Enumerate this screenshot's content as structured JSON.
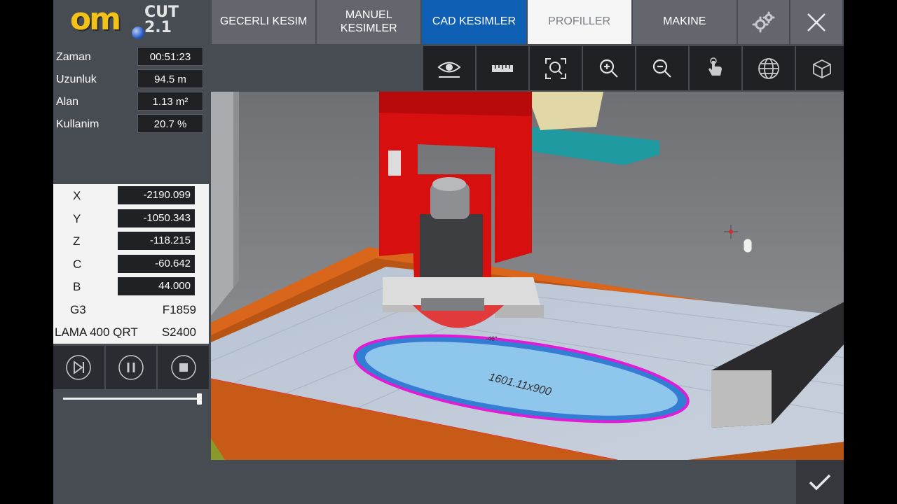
{
  "app": {
    "logo_text": "om",
    "version": "CUT 2.1"
  },
  "nav": {
    "tabs": [
      {
        "label": "GECERLI KESIM",
        "active": false
      },
      {
        "label": "MANUEL\nKESIMLER",
        "active": false
      },
      {
        "label": "CAD KESIMLER",
        "active": true
      },
      {
        "label": "PROFILLER",
        "active": false
      },
      {
        "label": "MAKINE",
        "active": false
      }
    ],
    "settings_icon": "gears-icon",
    "close_icon": "close-icon"
  },
  "toolbar": [
    "eye-icon",
    "ruler-icon",
    "zoom-fit-icon",
    "zoom-in-icon",
    "zoom-out-icon",
    "touch-hand-icon",
    "globe-icon",
    "cube-icon"
  ],
  "stats": [
    {
      "label": "Zaman",
      "value": "00:51:23"
    },
    {
      "label": "Uzunluk",
      "value": "94.5 m"
    },
    {
      "label": "Alan",
      "value": "1.13 m²"
    },
    {
      "label": "Kullanim",
      "value": "20.7 %"
    }
  ],
  "coords": [
    {
      "label": "X",
      "value": "-2190.099"
    },
    {
      "label": "Y",
      "value": "-1050.343"
    },
    {
      "label": "Z",
      "value": "-118.215"
    },
    {
      "label": "C",
      "value": "-60.642"
    },
    {
      "label": "B",
      "value": "44.000"
    }
  ],
  "status": {
    "gcode": "G3",
    "feed": "F1859",
    "tool": "LAMA 400 QRT",
    "speed": "S2400"
  },
  "playback": {
    "progress": 1.0
  },
  "viewport": {
    "shape_label": "1601.11x900",
    "angle_label": "-46°"
  },
  "colors": {
    "accent_active": "#0f5fb5",
    "tab_bg": "#63666d",
    "panel_bg": "#474b52",
    "machine_red": "#d80f0f",
    "cut_outline": "#e21bd6",
    "slab_fill": "#7fbde8",
    "table_orange": "#d9661a"
  }
}
